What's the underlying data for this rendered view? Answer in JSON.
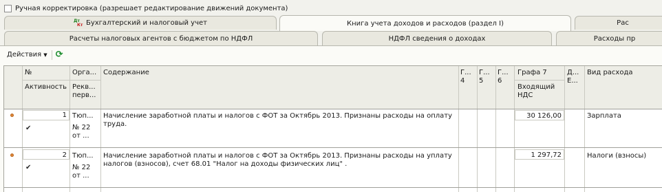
{
  "manual_edit": {
    "label": "Ручная корректировка (разрешает редактирование движений документа)",
    "checked": false
  },
  "tabs_row1": [
    {
      "label": "Бухгалтерский и налоговый учет",
      "icon": "dt-kt-icon"
    },
    {
      "label": "Книга учета доходов и расходов (раздел I)",
      "active": true
    },
    {
      "label": "Рас"
    }
  ],
  "tabs_row2": [
    {
      "label": "Расчеты налоговых агентов с бюджетом по НДФЛ"
    },
    {
      "label": "НДФЛ сведения о доходах"
    },
    {
      "label": "Расходы пр"
    }
  ],
  "toolbar": {
    "actions_label": "Действия",
    "refresh_icon": "refresh-icon"
  },
  "table": {
    "headers": {
      "num": "№",
      "activity": "Активность",
      "org": "Орга...",
      "rekv": "Рекв... перв...",
      "content": "Содержание",
      "g4": "Г... 4",
      "g5": "Г... 5",
      "g6": "Г... 6",
      "g7": "Графа 7",
      "vat": "Входящий НДС",
      "de": "Д... Е...",
      "expense_type": "Вид расхода"
    },
    "rows": [
      {
        "num": "1",
        "active": true,
        "org": "Тюп...",
        "rekv_line1": "№ 22",
        "rekv_line2": "от ...",
        "content": "Начисление заработной платы и налогов с ФОТ за Октябрь 2013. Признаны расходы на оплату труда.",
        "g7": "30 126,00",
        "expense_type": "Зарплата"
      },
      {
        "num": "2",
        "active": true,
        "org": "Тюп...",
        "rekv_line1": "№ 22",
        "rekv_line2": "от ...",
        "content": "Начисление заработной платы и налогов с ФОТ за Октябрь 2013. Признаны расходы на уплату налогов (взносов),  счет 68.01 \"Налог на доходы физических лиц\" .",
        "g7": "1 297,72",
        "expense_type": "Налоги (взносы)"
      }
    ]
  }
}
